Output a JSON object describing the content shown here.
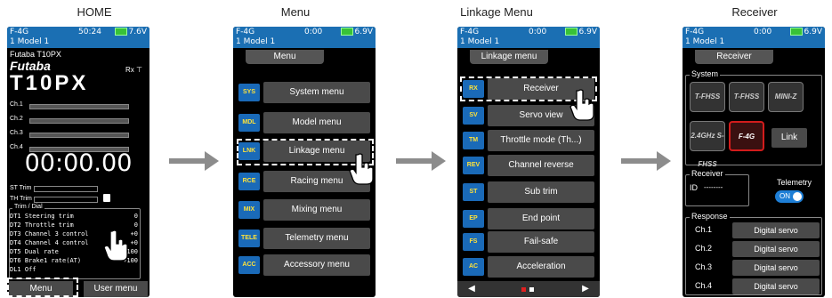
{
  "captions": [
    "HOME",
    "Menu",
    "Linkage Menu",
    "Receiver"
  ],
  "status": {
    "mode": "F-4G",
    "model": "1    Model 1",
    "time_home": "50:24",
    "volt_home": "7.6V",
    "time": "0:00",
    "volt": "6.9V"
  },
  "home": {
    "line1": "Futaba T10PX",
    "logo": "Futaba",
    "product": "T10PX",
    "rx": "Rx",
    "channels": [
      "Ch.1",
      "Ch.2",
      "Ch.3",
      "Ch.4"
    ],
    "timer": "00:00.00",
    "st_trim": "ST Trim",
    "th_trim": "TH Trim",
    "dial_title": "Trim / Dial",
    "dials": [
      {
        "k": "DT1",
        "n": "Steering trim",
        "v": "0"
      },
      {
        "k": "DT2",
        "n": "Throttle trim",
        "v": "0"
      },
      {
        "k": "DT3",
        "n": "Channel 3 control",
        "v": "+0"
      },
      {
        "k": "DT4",
        "n": "Channel 4 control",
        "v": "+0"
      },
      {
        "k": "DT5",
        "n": "Dual rate",
        "v": "+100"
      },
      {
        "k": "DT6",
        "n": "Brake1 rate(AT)",
        "v": "+100"
      },
      {
        "k": "DL1",
        "n": "Off",
        "v": ""
      }
    ],
    "menu_btn": "Menu",
    "user_btn": "User menu"
  },
  "menu": {
    "title": "Menu",
    "items": [
      {
        "icon": "SYS",
        "label": "System menu"
      },
      {
        "icon": "MDL",
        "label": "Model menu"
      },
      {
        "icon": "LNK",
        "label": "Linkage menu"
      },
      {
        "icon": "RCE",
        "label": "Racing menu"
      },
      {
        "icon": "MIX",
        "label": "Mixing menu"
      },
      {
        "icon": "TELE",
        "label": "Telemetry menu"
      },
      {
        "icon": "ACC",
        "label": "Accessory menu"
      }
    ]
  },
  "linkage": {
    "title": "Linkage menu",
    "items": [
      {
        "icon": "RX",
        "label": "Receiver"
      },
      {
        "icon": "SV",
        "label": "Servo view"
      },
      {
        "icon": "TM",
        "label": "Throttle mode (Th...)"
      },
      {
        "icon": "REV",
        "label": "Channel reverse"
      },
      {
        "icon": "ST",
        "label": "Sub trim"
      },
      {
        "icon": "EP",
        "label": "End point"
      },
      {
        "icon": "FS",
        "label": "Fail-safe"
      },
      {
        "icon": "AC",
        "label": "Acceleration"
      }
    ],
    "prev": "◀",
    "next": "▶"
  },
  "receiver": {
    "title": "Receiver",
    "system_label": "System",
    "tiles": [
      "T-FHSS SR",
      "T-FHSS",
      "MINI-Z",
      "2.4GHz S-FHSS",
      "F-4G"
    ],
    "link_btn": "Link",
    "receiver_label": "Receiver",
    "id_label": "ID",
    "id_value": "--------",
    "telemetry_label": "Telemetry",
    "telemetry_state": "ON",
    "response_label": "Response",
    "response": [
      {
        "ch": "Ch.1",
        "val": "Digital servo"
      },
      {
        "ch": "Ch.2",
        "val": "Digital servo"
      },
      {
        "ch": "Ch.3",
        "val": "Digital servo"
      },
      {
        "ch": "Ch.4",
        "val": "Digital servo"
      }
    ]
  },
  "colors": {
    "status_blue": "#1b6fb3",
    "button_gray": "#4a4a4a",
    "arrow_gray": "#8c8c8c",
    "toggle_blue": "#1e7fd6",
    "f4g_red": "#d21c1c"
  }
}
